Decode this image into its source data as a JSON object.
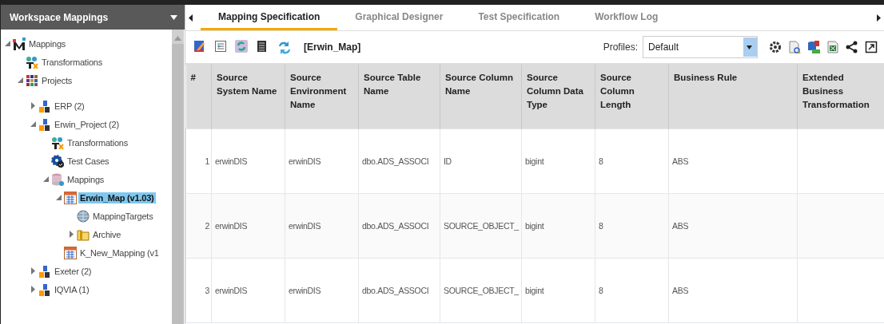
{
  "sidebar": {
    "title": "Workspace Mappings",
    "tree": [
      {
        "label": "Mappings",
        "kind": "m-logo",
        "expanded": true,
        "selected": false,
        "children": [
          {
            "label": "Transformations",
            "kind": "tx",
            "selected": false
          },
          {
            "label": "Projects",
            "kind": "grid",
            "expanded": true,
            "selected": false,
            "children": [
              {
                "label": "ERP (2)",
                "kind": "project",
                "expanded": false,
                "selected": false
              },
              {
                "label": "Erwin_Project (2)",
                "kind": "project",
                "expanded": true,
                "selected": false,
                "children": [
                  {
                    "label": "Transformations",
                    "kind": "tx",
                    "selected": false
                  },
                  {
                    "label": "Test Cases",
                    "kind": "gear",
                    "selected": false
                  },
                  {
                    "label": "Mappings",
                    "kind": "database",
                    "expanded": true,
                    "selected": false,
                    "children": [
                      {
                        "label": "Erwin_Map (v1.03)",
                        "kind": "calendar",
                        "expanded": true,
                        "selected": true,
                        "children": [
                          {
                            "label": "MappingTargets",
                            "kind": "globe",
                            "selected": false
                          },
                          {
                            "label": "Archive",
                            "kind": "folder",
                            "expanded": false,
                            "selected": false
                          }
                        ]
                      },
                      {
                        "label": "K_New_Mapping (v1",
                        "kind": "calendar",
                        "selected": false
                      }
                    ]
                  }
                ]
              },
              {
                "label": "Exeter (2)",
                "kind": "project",
                "expanded": false,
                "selected": false
              },
              {
                "label": "IQVIA (1)",
                "kind": "project",
                "expanded": false,
                "selected": false
              }
            ]
          }
        ]
      }
    ]
  },
  "tabs": [
    {
      "label": "Mapping Specification",
      "selected": true
    },
    {
      "label": "Graphical Designer",
      "selected": false
    },
    {
      "label": "Test Specification",
      "selected": false
    },
    {
      "label": "Workflow Log",
      "selected": false
    }
  ],
  "toolbar": {
    "map_name": "[Erwin_Map]",
    "profiles_label": "Profiles:",
    "profile_value": "Default"
  },
  "table": {
    "columns": [
      "#",
      "Source System Name",
      "Source Environment Name",
      "Source Table Name",
      "Source Column Name",
      "Source Column Data Type",
      "Source Column Length",
      "Business Rule",
      "Extended Business Transformation"
    ],
    "rows": [
      [
        "1",
        "erwinDIS",
        "erwinDIS",
        "dbo.ADS_ASSOCI",
        "ID",
        "bigint",
        "8",
        "ABS",
        ""
      ],
      [
        "2",
        "erwinDIS",
        "erwinDIS",
        "dbo.ADS_ASSOCI",
        "SOURCE_OBJECT_",
        "bigint",
        "8",
        "ABS",
        ""
      ],
      [
        "3",
        "erwinDIS",
        "erwinDIS",
        "dbo.ADS_ASSOCI",
        "SOURCE_OBJECT_",
        "bigint",
        "8",
        "ABS",
        ""
      ]
    ]
  }
}
